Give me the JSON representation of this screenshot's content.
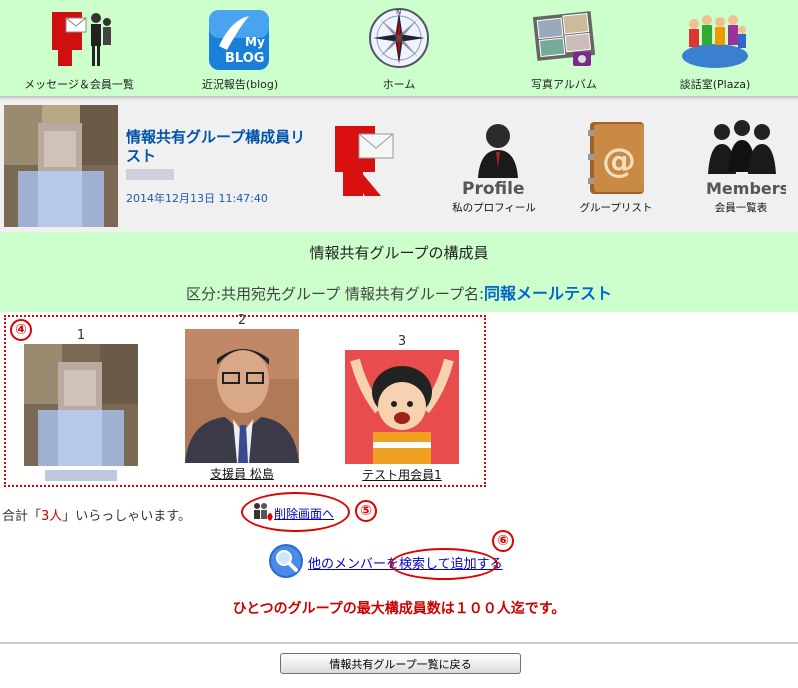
{
  "nav": {
    "items": [
      {
        "label": "メッセージ＆会員一覧",
        "icon": "message-icon"
      },
      {
        "label": "近況報告(blog)",
        "icon": "blog-icon"
      },
      {
        "label": "ホーム",
        "icon": "compass-icon"
      },
      {
        "label": "写真アルバム",
        "icon": "photo-album-icon"
      },
      {
        "label": "談話室(Plaza)",
        "icon": "plaza-icon"
      }
    ]
  },
  "header": {
    "title": "情報共有グループ構成員リスト",
    "datetime": "2014年12月13日 11:47:40",
    "icons": [
      {
        "label": "",
        "icon": "message-logo-icon"
      },
      {
        "label": "私のプロフィール",
        "icon": "profile-icon",
        "caption": "Profile"
      },
      {
        "label": "グループリスト",
        "icon": "address-book-icon"
      },
      {
        "label": "会員一覧表",
        "icon": "members-icon",
        "caption": "Members"
      }
    ]
  },
  "info": {
    "title": "情報共有グループの構成員",
    "category_prefix": "区分:共用宛先グループ 情報共有グループ名:",
    "group_name": "同報メールテスト"
  },
  "members": [
    {
      "number": "1",
      "name": ""
    },
    {
      "number": "2",
      "name": "支援員 松島"
    },
    {
      "number": "3",
      "name": "テスト用会員1"
    }
  ],
  "annotations": {
    "a4": "④",
    "a5": "⑤",
    "a6": "⑥"
  },
  "summary": {
    "total_prefix": "合計「",
    "total_count": "3人",
    "total_suffix": "」いらっしゃいます。",
    "delete_link": "削除画面へ"
  },
  "search": {
    "link": "他のメンバーを検索して追加する"
  },
  "notice": "ひとつのグループの最大構成員数は１００人迄です。",
  "footer": {
    "back_button": "情報共有グループ一覧に戻る"
  },
  "colors": {
    "nav_bg": "#ccffcc",
    "accent_blue": "#0066cc",
    "alert_red": "#cc0000"
  }
}
